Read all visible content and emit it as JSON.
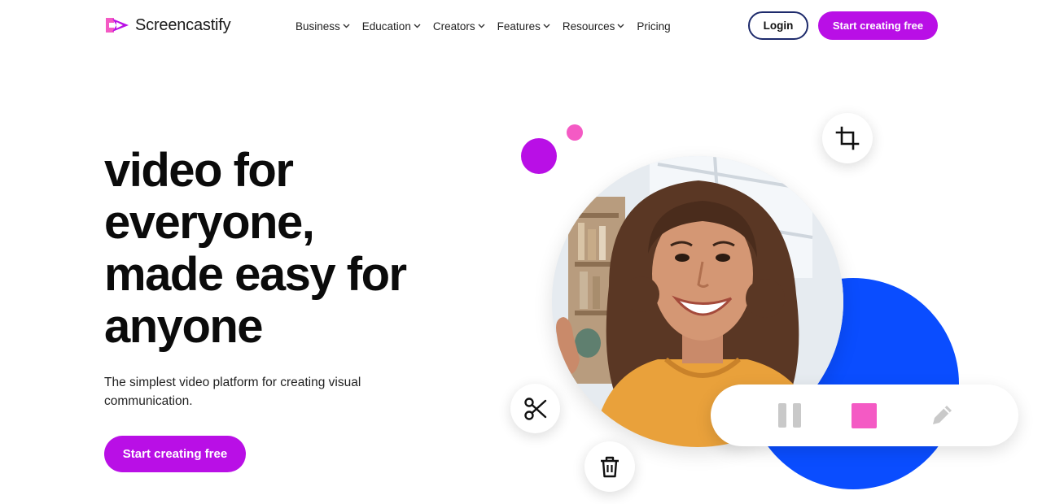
{
  "brand": {
    "name": "Screencastify",
    "accent": "#b90fe6",
    "logo_pink": "#f45ac4",
    "blue": "#0a4dff"
  },
  "nav": {
    "items": [
      {
        "label": "Business",
        "has_dropdown": true
      },
      {
        "label": "Education",
        "has_dropdown": true
      },
      {
        "label": "Creators",
        "has_dropdown": true
      },
      {
        "label": "Features",
        "has_dropdown": true
      },
      {
        "label": "Resources",
        "has_dropdown": true
      },
      {
        "label": "Pricing",
        "has_dropdown": false
      }
    ],
    "login_label": "Login",
    "cta_label": "Start creating free"
  },
  "hero": {
    "title_lines": [
      "video for",
      "everyone,",
      "made easy for",
      "anyone"
    ],
    "subtitle": "The simplest video platform for creating visual communication.",
    "cta_label": "Start creating free"
  },
  "illustration": {
    "floating_icons": [
      "crop-icon",
      "scissors-icon",
      "trash-icon"
    ],
    "recorder_controls": [
      "pause-icon",
      "stop-icon",
      "pencil-icon"
    ]
  }
}
